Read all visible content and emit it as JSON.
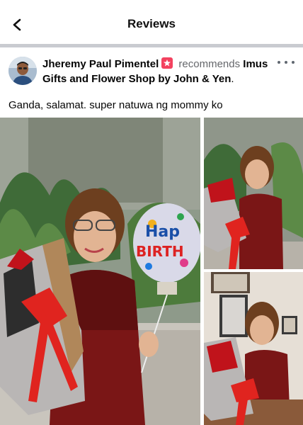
{
  "header": {
    "back_icon": "chevron-left-icon",
    "title": "Reviews"
  },
  "post": {
    "author": "Jheremy Paul Pimentel",
    "badge_icon": "top-fan-badge-icon",
    "verb": "recommends",
    "page_name": "Imus Gifts and Flower Shop by John & Yen",
    "more_icon": "more-options-icon",
    "text": "Ganda, salamat. super natuwa ng mommy ko",
    "photos": [
      {
        "name": "photo-woman-with-balloon-and-flowers",
        "balloon_text": "Happy BIRTHDAY"
      },
      {
        "name": "photo-woman-holding-bouquet"
      },
      {
        "name": "photo-woman-with-bouquet-indoors"
      }
    ]
  },
  "colors": {
    "divider": "#c9cbd0",
    "badge": "#f3425f",
    "secondary_text": "#65676b",
    "dress": "#7a1616",
    "ribbon": "#e0241f"
  }
}
